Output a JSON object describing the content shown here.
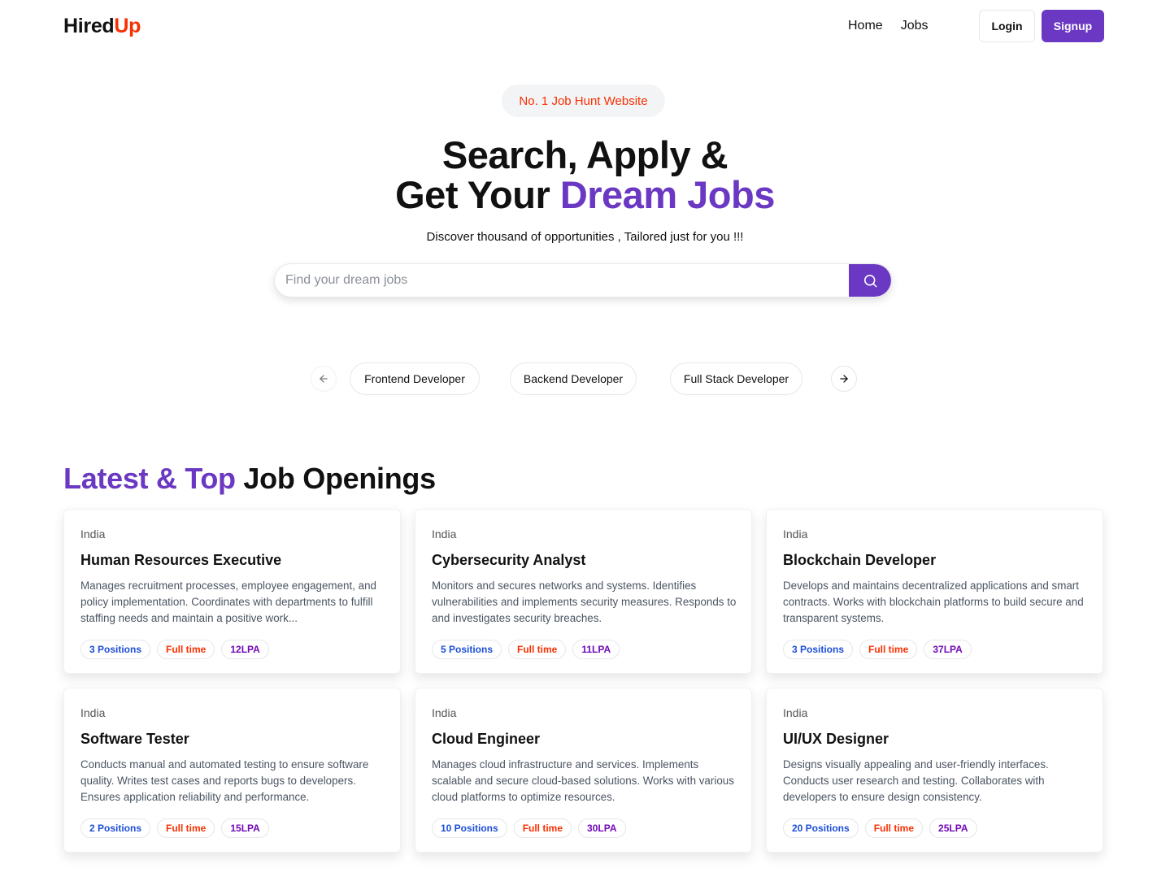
{
  "brand": {
    "part1": "Hired",
    "part2": "Up",
    "accent_color": "#f83002"
  },
  "nav": {
    "links": [
      "Home",
      "Jobs"
    ],
    "login_label": "Login",
    "signup_label": "Signup"
  },
  "hero": {
    "badge": "No. 1 Job Hunt Website",
    "title_line1": "Search, Apply &",
    "title_line2_prefix": "Get Your ",
    "title_line2_accent": "Dream Jobs",
    "subtitle": "Discover thousand of opportunities , Tailored just for you !!!",
    "primary_color": "#6a38c2"
  },
  "search": {
    "placeholder": "Find your dream jobs",
    "value": "",
    "button_icon": "search-icon"
  },
  "categories": {
    "prev_icon": "arrow-left-icon",
    "next_icon": "arrow-right-icon",
    "items": [
      "Frontend Developer",
      "Backend Developer",
      "Full Stack Developer"
    ]
  },
  "section": {
    "title_accent": "Latest & Top",
    "title_rest": " Job Openings"
  },
  "jobs": [
    {
      "location": "India",
      "title": "Human Resources Executive",
      "description": "Manages recruitment processes, employee engagement, and policy implementation. Coordinates with departments to fulfill staffing needs and maintain a positive work...",
      "positions": "3 Positions",
      "type": "Full time",
      "salary": "12LPA"
    },
    {
      "location": "India",
      "title": "Cybersecurity Analyst",
      "description": "Monitors and secures networks and systems. Identifies vulnerabilities and implements security measures. Responds to and investigates security breaches.",
      "positions": "5 Positions",
      "type": "Full time",
      "salary": "11LPA"
    },
    {
      "location": "India",
      "title": "Blockchain Developer",
      "description": "Develops and maintains decentralized applications and smart contracts. Works with blockchain platforms to build secure and transparent systems.",
      "positions": "3 Positions",
      "type": "Full time",
      "salary": "37LPA"
    },
    {
      "location": "India",
      "title": "Software Tester",
      "description": "Conducts manual and automated testing to ensure software quality. Writes test cases and reports bugs to developers. Ensures application reliability and performance.",
      "positions": "2 Positions",
      "type": "Full time",
      "salary": "15LPA"
    },
    {
      "location": "India",
      "title": "Cloud Engineer",
      "description": "Manages cloud infrastructure and services. Implements scalable and secure cloud-based solutions. Works with various cloud platforms to optimize resources.",
      "positions": "10 Positions",
      "type": "Full time",
      "salary": "30LPA"
    },
    {
      "location": "India",
      "title": "UI/UX Designer",
      "description": "Designs visually appealing and user-friendly interfaces. Conducts user research and testing. Collaborates with developers to ensure design consistency.",
      "positions": "20 Positions",
      "type": "Full time",
      "salary": "25LPA"
    }
  ]
}
